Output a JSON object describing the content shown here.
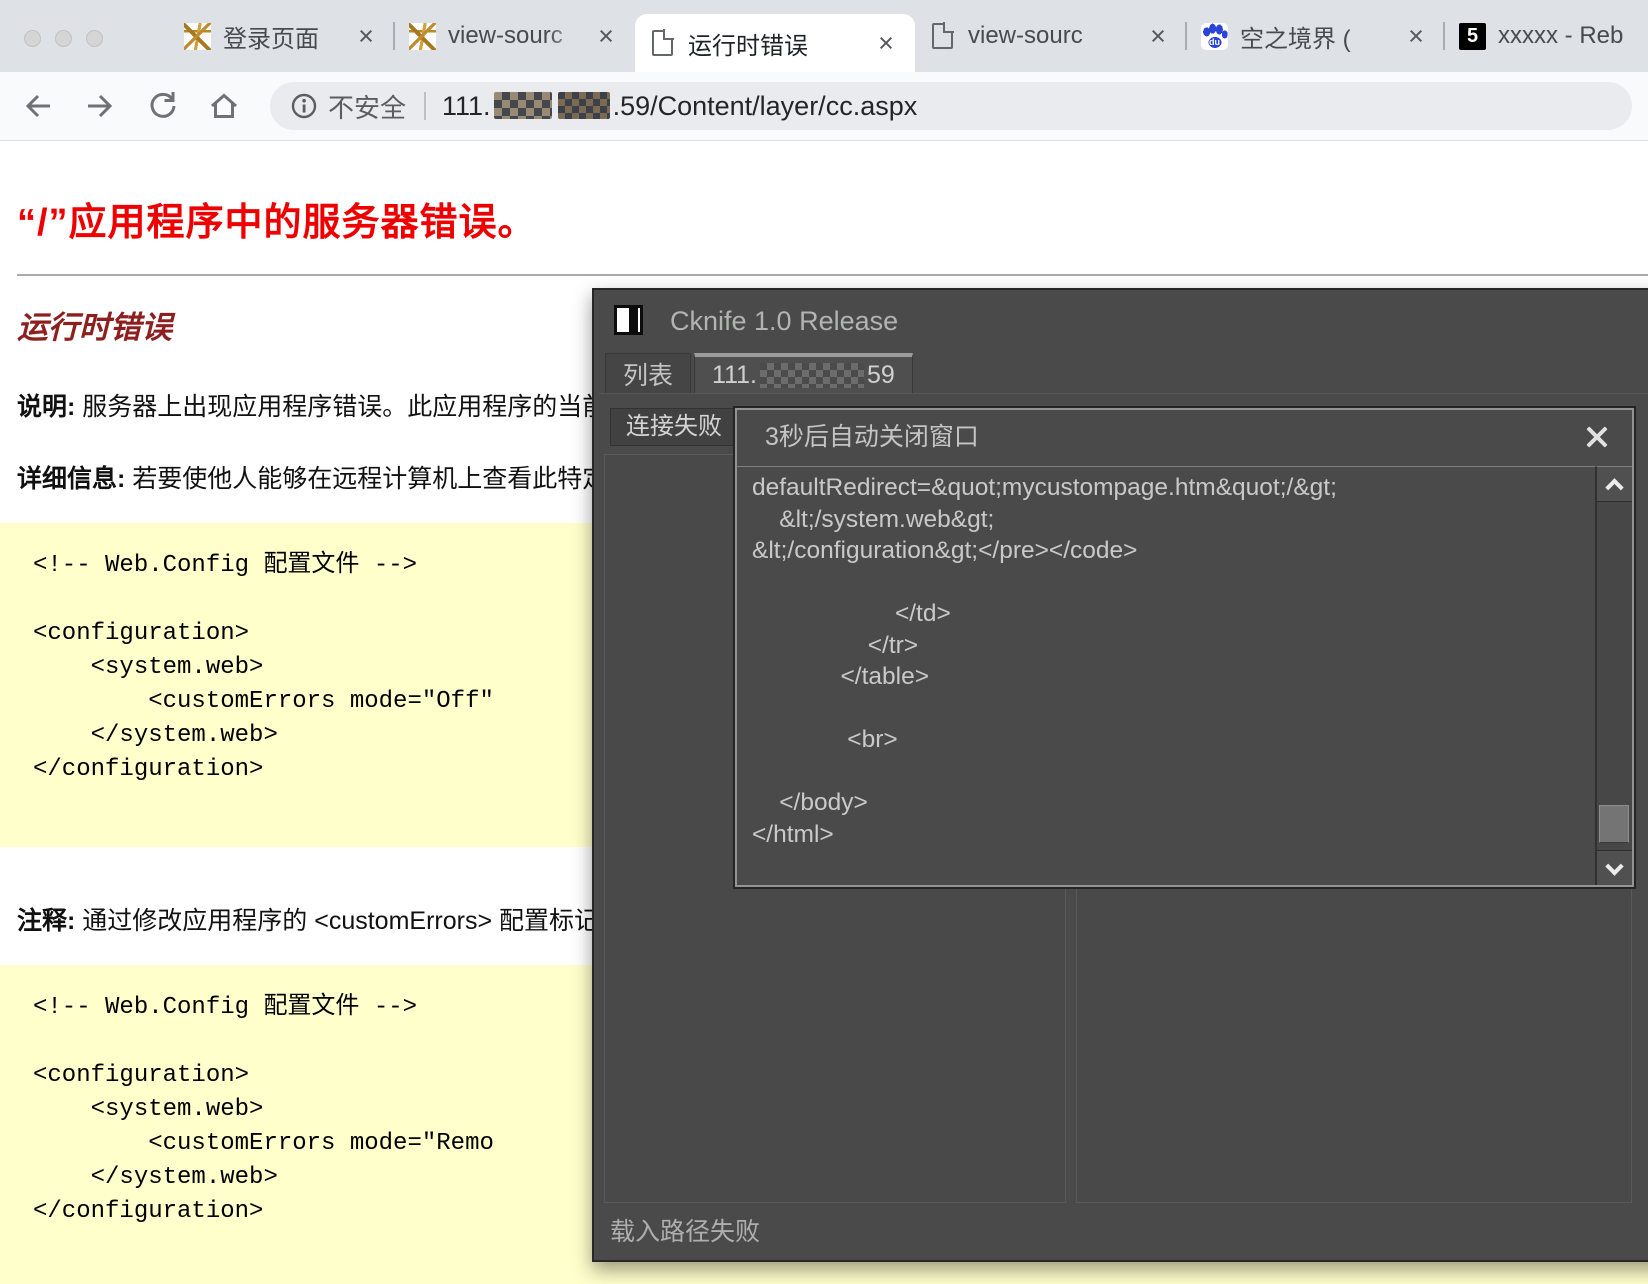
{
  "colors": {
    "error_red": "#ee0000",
    "runtime_maroon": "#8d1f1f",
    "code_bg": "#ffffcc",
    "window_bg": "#4a4a4b",
    "tabstrip_bg": "#dee1e6",
    "baidu_blue": "#2b43d7"
  },
  "browser": {
    "tabs": [
      {
        "title": "登录页面",
        "icon": "fav-gold",
        "close": true,
        "state": "",
        "fade": "",
        "divider": "divided"
      },
      {
        "title": "view-sourc",
        "icon": "fav-gold",
        "close": true,
        "state": "",
        "fade": "fade",
        "divider": ""
      },
      {
        "title": "运行时错误",
        "icon": "fav-doc",
        "close": true,
        "state": "active",
        "fade": "",
        "divider": ""
      },
      {
        "title": "view-sourc",
        "icon": "fav-doc",
        "close": true,
        "state": "",
        "fade": "fade",
        "divider": "divided"
      },
      {
        "title": "空之境界 (",
        "icon": "fav-baidu",
        "close": true,
        "state": "",
        "fade": "fade",
        "divider": "divided"
      },
      {
        "title": "xxxxx - Reb",
        "icon": "fav-five",
        "close": false,
        "state": "",
        "fade": "fade",
        "divider": ""
      }
    ],
    "toolbar": {
      "security_label": "不安全",
      "url_prefix": "111.",
      "url_suffix": ".59/Content/layer/cc.aspx"
    }
  },
  "page": {
    "error_title": "“/”应用程序中的服务器错误。",
    "runtime_title": "运行时错误",
    "desc_label": "说明:",
    "desc_text": " 服务器上出现应用程序错误。此应用程序的当前",
    "details_label": "详细信息:",
    "details_text": " 若要使他人能够在远程计算机上查看此特定错",
    "comment_label": "注释:",
    "comment_text": " 通过修改应用程序的 <customErrors> 配置标记的",
    "web_config_block_1": [
      "<!-- Web.Config 配置文件 -->",
      "",
      "<configuration>",
      "    <system.web>",
      "        <customErrors mode=\"Off\"",
      "    </system.web>",
      "</configuration>"
    ],
    "web_config_block_2": [
      "<!-- Web.Config 配置文件 -->",
      "",
      "<configuration>",
      "    <system.web>",
      "        <customErrors mode=\"Remo",
      "    </system.web>",
      "</configuration>"
    ]
  },
  "cknife": {
    "window_title": "Cknife 1.0 Release",
    "list_tab": "列表",
    "ip_tab_prefix": "111.",
    "ip_tab_suffix": "59",
    "connection_tab": "连接失败",
    "status_text": "载入路径失败",
    "popup": {
      "title": "3秒后自动关闭窗口",
      "lines": [
        "defaultRedirect=&quot;mycustompage.htm&quot;/&gt;",
        "    &lt;/system.web&gt;",
        "&lt;/configuration&gt;</pre></code>",
        "",
        "                     </td>",
        "                 </tr>",
        "             </table>",
        "",
        "              <br>",
        "",
        "    </body>",
        "</html>"
      ]
    }
  }
}
